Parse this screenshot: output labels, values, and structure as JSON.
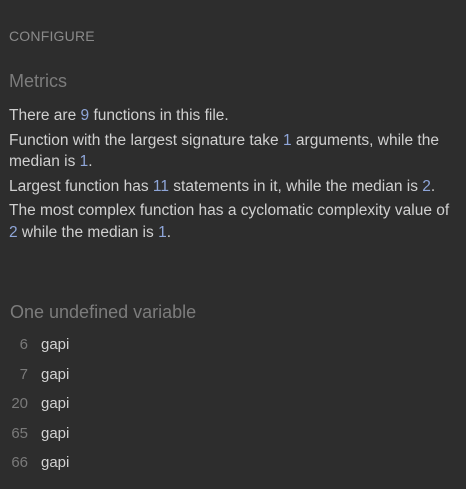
{
  "header": {
    "configure_label": "CONFIGURE"
  },
  "metrics": {
    "title": "Metrics",
    "line1": {
      "before": "There are ",
      "count": "9",
      "after": " functions in this file."
    },
    "line2": {
      "before": "Function with the largest signature take ",
      "max_args": "1",
      "middle": " arguments, while the median is ",
      "median": "1",
      "end": "."
    },
    "line3": {
      "before": "Largest function has ",
      "max_statements": "11",
      "middle": " statements in it, while the median is ",
      "median": "2",
      "end": "."
    },
    "line4": {
      "before": "The most complex function has a cyclomatic complexity value of ",
      "max_complexity": "2",
      "middle": " while the median is ",
      "median": "1",
      "end": "."
    }
  },
  "undefined": {
    "title": "One undefined variable",
    "rows": [
      {
        "line": "6",
        "name": "gapi"
      },
      {
        "line": "7",
        "name": "gapi"
      },
      {
        "line": "20",
        "name": "gapi"
      },
      {
        "line": "65",
        "name": "gapi"
      },
      {
        "line": "66",
        "name": "gapi"
      }
    ]
  },
  "colors": {
    "background": "#2d2d2d",
    "text": "#d0d0d0",
    "heading": "#7c7c7c",
    "number_accent": "#8fa6d9"
  }
}
